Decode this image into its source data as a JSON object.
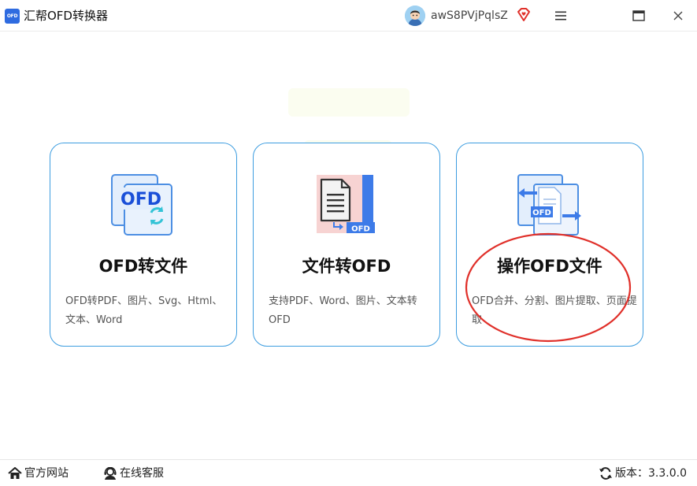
{
  "app": {
    "title": "汇帮OFD转换器",
    "logo_text": "OFD",
    "accent": "#2e6be0"
  },
  "user": {
    "name": "awS8PVjPqlsZ",
    "vip_icon": "diamond-heart-icon"
  },
  "window_controls": {
    "menu_icon": "hamburger-icon",
    "maximize_icon": "maximize-icon",
    "close_icon": "close-icon"
  },
  "cards": [
    {
      "title": "OFD转文件",
      "desc": "OFD转PDF、图片、Svg、Html、文本、Word",
      "icon": "ofd-convert-icon",
      "icon_text": "OFD"
    },
    {
      "title": "文件转OFD",
      "desc": "支持PDF、Word、图片、文本转OFD",
      "icon": "file-to-ofd-icon",
      "icon_text": "OFD"
    },
    {
      "title": "操作OFD文件",
      "desc": "OFD合并、分割、图片提取、页面提取",
      "icon": "ofd-operate-icon",
      "icon_text": "OFD"
    }
  ],
  "annotation_color": "#e0302a",
  "bottom": {
    "site_label": "官方网站",
    "service_label": "在线客服",
    "version_label": "版本：3.3.0.0"
  }
}
